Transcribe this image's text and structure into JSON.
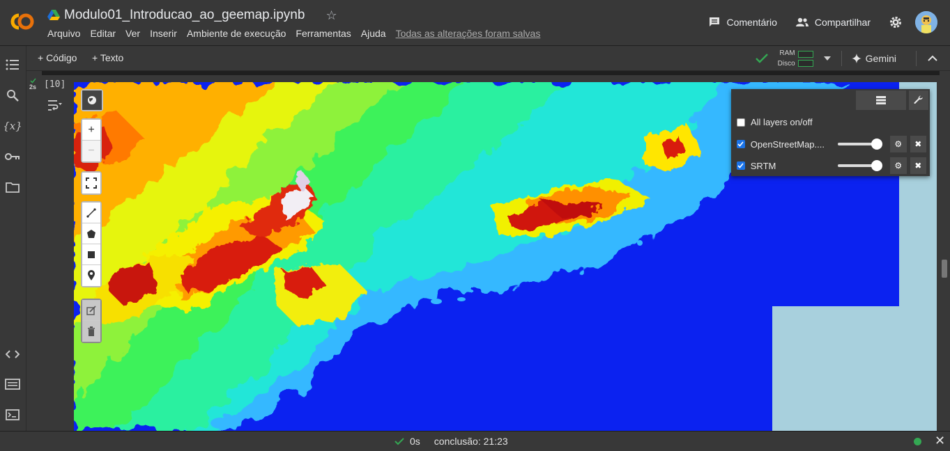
{
  "app": {
    "doc_title": "Modulo01_Introducao_ao_geemap.ipynb",
    "logo_text": "CO"
  },
  "menu": {
    "items": [
      "Arquivo",
      "Editar",
      "Ver",
      "Inserir",
      "Ambiente de execução",
      "Ferramentas",
      "Ajuda"
    ],
    "save_status": "Todas as alterações foram salvas"
  },
  "header_actions": {
    "comment_label": "Comentário",
    "share_label": "Compartilhar"
  },
  "toolbar": {
    "add_code_label": "+ Código",
    "add_text_label": "+ Texto",
    "ram_label": "RAM",
    "disk_label": "Disco",
    "gemini_label": "Gemini"
  },
  "cell": {
    "exec_time": "2s",
    "exec_count": "[10]"
  },
  "layer_panel": {
    "all_layers_label": "All layers on/off",
    "all_layers_checked": false,
    "layers": [
      {
        "name": "OpenStreetMap....",
        "checked": true,
        "opacity": 1.0
      },
      {
        "name": "SRTM",
        "checked": true,
        "opacity": 1.0
      }
    ]
  },
  "status_bar": {
    "duration": "0s",
    "completion": "conclusão: 21:23"
  },
  "colors": {
    "accent_green": "#34a853",
    "checkbox_blue": "#1a73e8",
    "colab_orange": "#f9ab00",
    "map_water": "#0b22f0",
    "map_sea_fill": "#a8d0dd"
  }
}
